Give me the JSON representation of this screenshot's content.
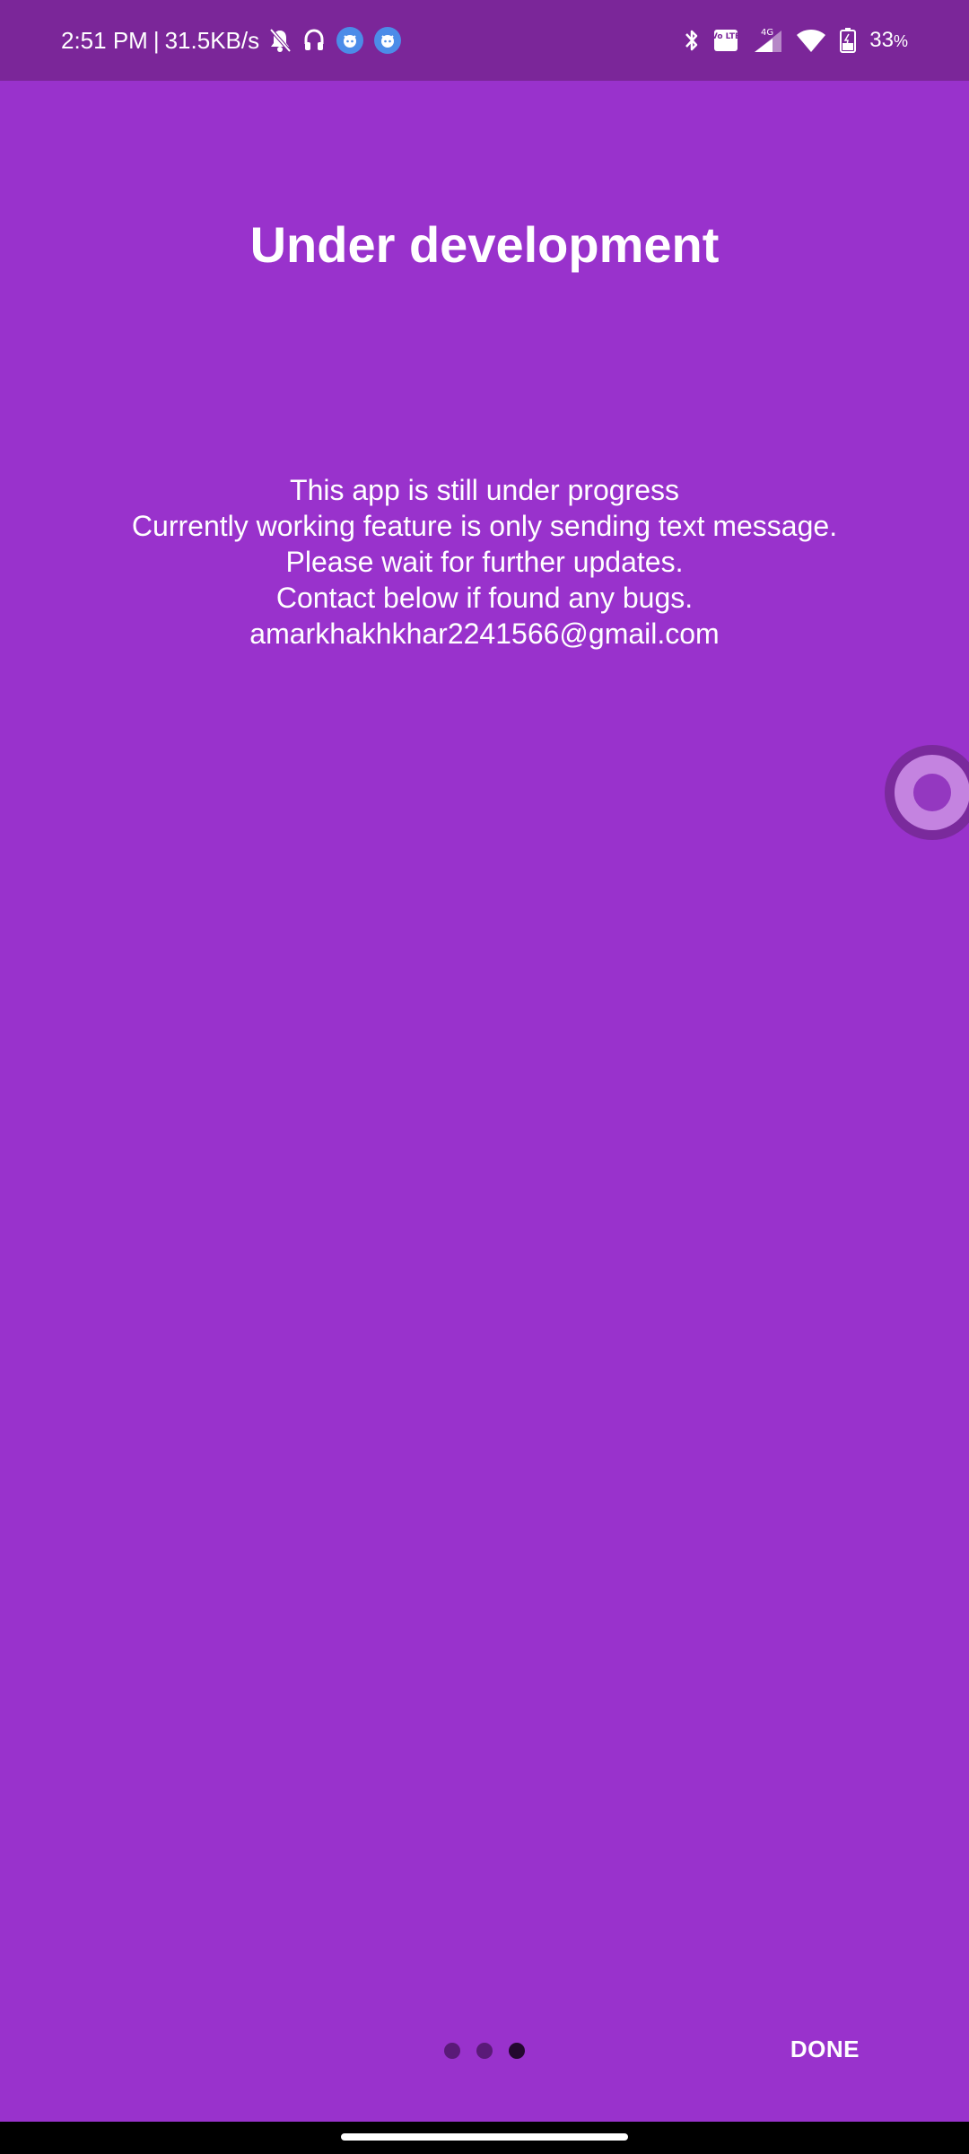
{
  "status_bar": {
    "time": "2:51 PM",
    "separator": "|",
    "network_speed": "31.5KB/s",
    "left_icons": [
      "bell-off-icon",
      "headphones-icon",
      "app-badge-icon",
      "app-badge-icon"
    ],
    "right_icons": [
      "bluetooth-icon",
      "volte-icon",
      "signal-4g-icon",
      "wifi-icon",
      "battery-icon"
    ],
    "signal_type": "4G",
    "volte_label": "Vo LTE",
    "battery": "33",
    "battery_unit": "%"
  },
  "page": {
    "title": "Under development",
    "message_lines": [
      "This app is still under progress",
      "Currently working feature is only sending text message.",
      "Please wait for further updates.",
      "Contact below if found any bugs.",
      "amarkhakhkhar2241566@gmail.com"
    ]
  },
  "pager": {
    "dot_count": 3,
    "active_index": 2
  },
  "done_button": "DONE",
  "floating_button": "target-icon",
  "colors": {
    "background": "#9932cc",
    "status_bar": "#7b2699",
    "dot": "#5a1a78",
    "dot_active": "#24082f",
    "nav_bar": "#000000"
  }
}
